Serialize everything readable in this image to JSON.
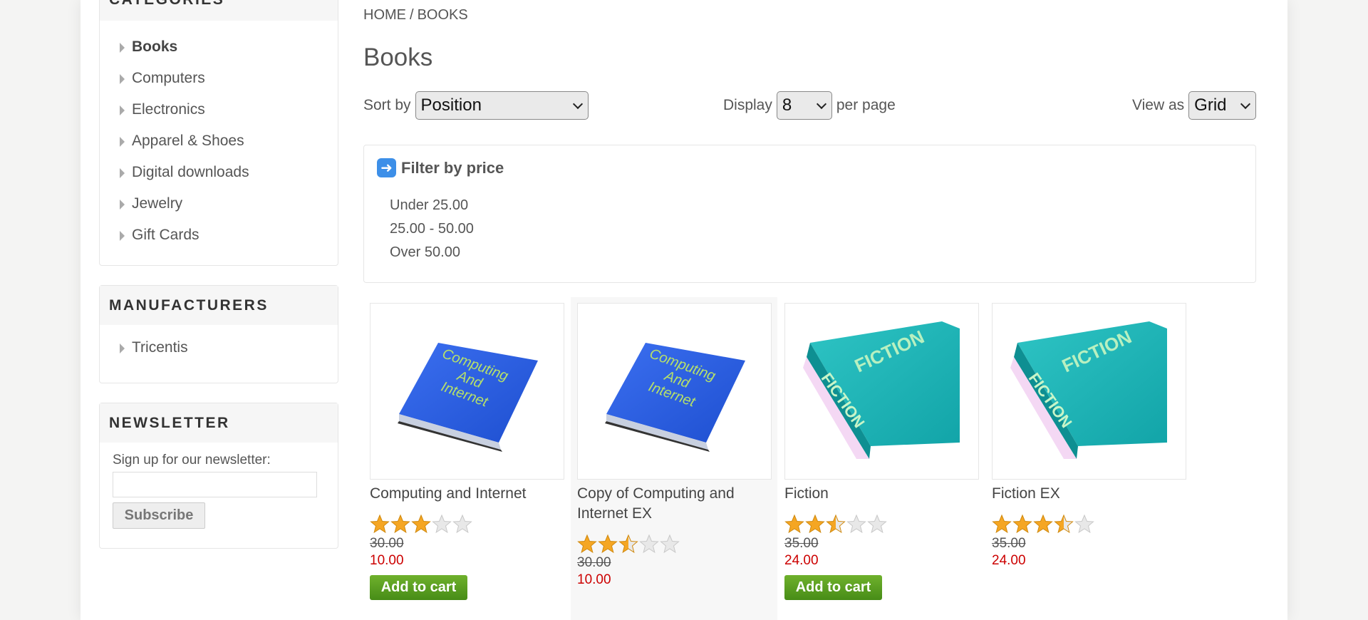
{
  "sidebar": {
    "categories": {
      "title": "CATEGORIES",
      "items": [
        {
          "label": "Books"
        },
        {
          "label": "Computers"
        },
        {
          "label": "Electronics"
        },
        {
          "label": "Apparel & Shoes"
        },
        {
          "label": "Digital downloads"
        },
        {
          "label": "Jewelry"
        },
        {
          "label": "Gift Cards"
        }
      ]
    },
    "manufacturers": {
      "title": "MANUFACTURERS",
      "items": [
        {
          "label": "Tricentis"
        }
      ]
    },
    "newsletter": {
      "title": "NEWSLETTER",
      "label": "Sign up for our newsletter:",
      "input_value": "",
      "button": "Subscribe"
    }
  },
  "breadcrumb": {
    "home": "HOME",
    "separator": "/",
    "current": "BOOKS"
  },
  "page_title": "Books",
  "toolbar": {
    "sort_label": "Sort by",
    "sort_value": "Position",
    "display_label": "Display",
    "display_value": "8",
    "per_page": "per page",
    "view_label": "View as",
    "view_value": "Grid"
  },
  "filter": {
    "title": "Filter by price",
    "options": [
      "Under 25.00",
      "25.00 - 50.00",
      "Over 50.00"
    ]
  },
  "products": [
    {
      "name": "Computing and Internet",
      "rating_stars": 3,
      "old_price": "30.00",
      "price": "10.00",
      "cart": "Add to cart"
    },
    {
      "name": "Copy of Computing and Internet EX",
      "rating_stars": 2.5,
      "old_price": "30.00",
      "price": "10.00",
      "cart": ""
    },
    {
      "name": "Fiction",
      "rating_stars": 2.5,
      "old_price": "35.00",
      "price": "24.00",
      "cart": "Add to cart"
    },
    {
      "name": "Fiction EX",
      "rating_stars": 3.5,
      "old_price": "35.00",
      "price": "24.00",
      "cart": ""
    }
  ],
  "book_covers": {
    "computing": [
      "Computing",
      "And",
      "Internet"
    ],
    "fiction": "FICTION"
  },
  "colors": {
    "price_red": "#cc0000",
    "cart_green": "#5a9e22",
    "star_gold": "#f5a623"
  }
}
